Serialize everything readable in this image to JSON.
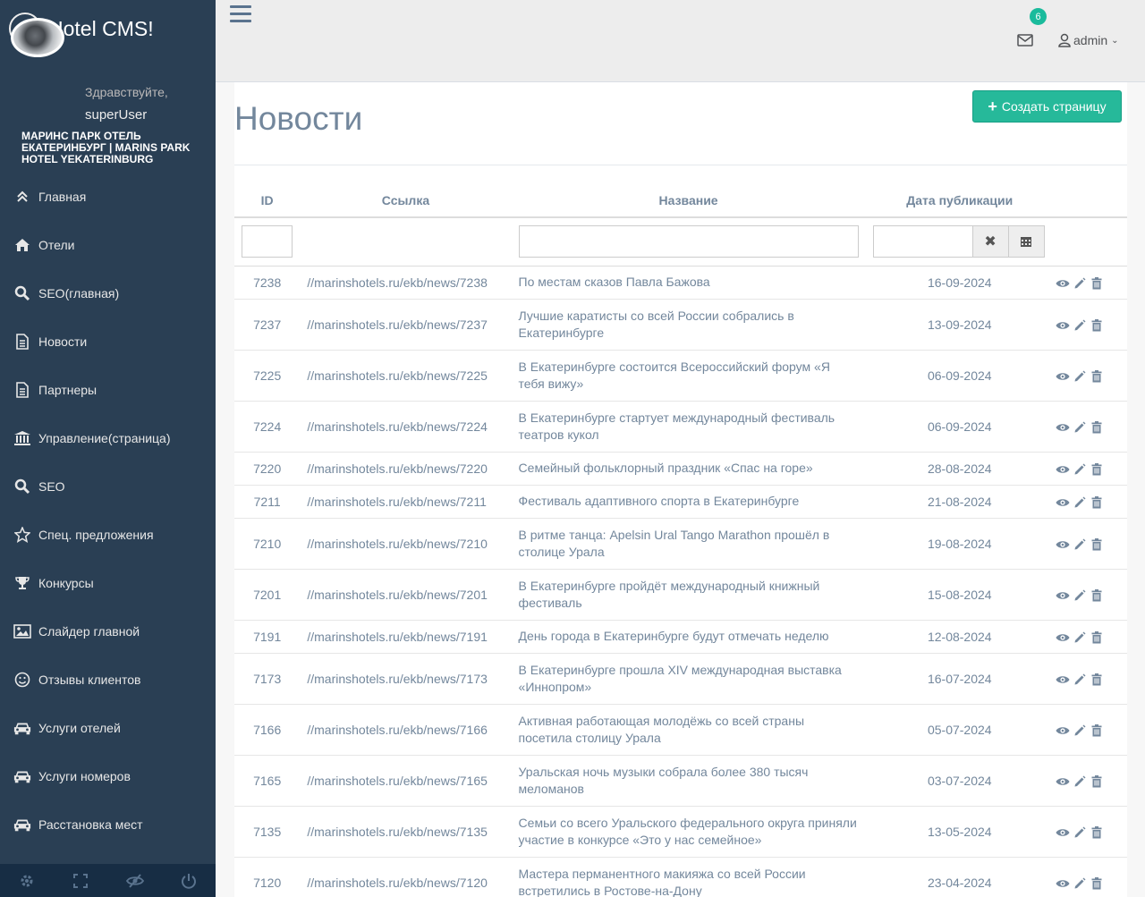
{
  "brand": {
    "title": "Hotel CMS!"
  },
  "profile": {
    "welcome": "Здравствуйте,",
    "username": "superUser",
    "hotel": "Маринс Парк Отель Екатеринбург | Marins Park Hotel Yekaterinburg"
  },
  "sidebar": {
    "items": [
      {
        "label": "Главная",
        "icon": "double-chevron-up-icon"
      },
      {
        "label": "Отели",
        "icon": "home-icon"
      },
      {
        "label": "SEO(главная)",
        "icon": "search-icon"
      },
      {
        "label": "Новости",
        "icon": "document-icon"
      },
      {
        "label": "Партнеры",
        "icon": "document-icon"
      },
      {
        "label": "Управление(страница)",
        "icon": "bank-icon"
      },
      {
        "label": "SEO",
        "icon": "search-icon"
      },
      {
        "label": "Спец. предложения",
        "icon": "star-icon"
      },
      {
        "label": "Конкурсы",
        "icon": "trophy-icon"
      },
      {
        "label": "Слайдер главной",
        "icon": "image-icon"
      },
      {
        "label": "Отзывы клиентов",
        "icon": "smile-icon"
      },
      {
        "label": "Услуги отелей",
        "icon": "car-icon"
      },
      {
        "label": "Услуги номеров",
        "icon": "car-icon"
      },
      {
        "label": "Расстановка мест",
        "icon": "car-icon"
      }
    ]
  },
  "topnav": {
    "badge": "6",
    "user": "admin"
  },
  "page": {
    "title": "Новости",
    "create_label": "Создать страницу"
  },
  "table": {
    "headers": {
      "id": "ID",
      "link": "Ссылка",
      "name": "Название",
      "date": "Дата публикации"
    },
    "rows": [
      {
        "id": "7238",
        "link": "//marinshotels.ru/ekb/news/7238",
        "name": "По местам сказов Павла Бажова",
        "date": "16-09-2024"
      },
      {
        "id": "7237",
        "link": "//marinshotels.ru/ekb/news/7237",
        "name": "Лучшие каратисты со всей России собрались в Екатеринбурге",
        "date": "13-09-2024"
      },
      {
        "id": "7225",
        "link": "//marinshotels.ru/ekb/news/7225",
        "name": "В Екатеринбурге состоится Всероссийский форум «Я тебя вижу»",
        "date": "06-09-2024"
      },
      {
        "id": "7224",
        "link": "//marinshotels.ru/ekb/news/7224",
        "name": "В Екатеринбурге стартует международный фестиваль театров кукол",
        "date": "06-09-2024"
      },
      {
        "id": "7220",
        "link": "//marinshotels.ru/ekb/news/7220",
        "name": "Семейный фольклорный праздник «Спас на горе»",
        "date": "28-08-2024"
      },
      {
        "id": "7211",
        "link": "//marinshotels.ru/ekb/news/7211",
        "name": "Фестиваль адаптивного спорта в Екатеринбурге",
        "date": "21-08-2024"
      },
      {
        "id": "7210",
        "link": "//marinshotels.ru/ekb/news/7210",
        "name": "В ритме танца: Apelsin Ural Tango Marathon прошёл в столице Урала",
        "date": "19-08-2024"
      },
      {
        "id": "7201",
        "link": "//marinshotels.ru/ekb/news/7201",
        "name": "В Екатеринбурге пройдёт международный книжный фестиваль",
        "date": "15-08-2024"
      },
      {
        "id": "7191",
        "link": "//marinshotels.ru/ekb/news/7191",
        "name": "День города в Екатеринбурге будут отмечать неделю",
        "date": "12-08-2024"
      },
      {
        "id": "7173",
        "link": "//marinshotels.ru/ekb/news/7173",
        "name": "В Екатеринбурге прошла XIV международная выставка «Иннопром»",
        "date": "16-07-2024"
      },
      {
        "id": "7166",
        "link": "//marinshotels.ru/ekb/news/7166",
        "name": "Активная работающая молодёжь со всей страны посетила столицу Урала",
        "date": "05-07-2024"
      },
      {
        "id": "7165",
        "link": "//marinshotels.ru/ekb/news/7165",
        "name": "Уральская ночь музыки собрала более 380 тысяч меломанов",
        "date": "03-07-2024"
      },
      {
        "id": "7135",
        "link": "//marinshotels.ru/ekb/news/7135",
        "name": "Семьи со всего Уральского федерального округа приняли участие в конкурсе «Это у нас семейное»",
        "date": "13-05-2024"
      },
      {
        "id": "7120",
        "link": "//marinshotels.ru/ekb/news/7120",
        "name": "Мастера перманентного макияжа со всей России встретились в Ростове-на-Дону",
        "date": "23-04-2024"
      }
    ]
  },
  "colors": {
    "sidebar": "#2a3f54",
    "sidebar_footer": "#172d44",
    "accent": "#26b99a",
    "text": "#73879c"
  }
}
